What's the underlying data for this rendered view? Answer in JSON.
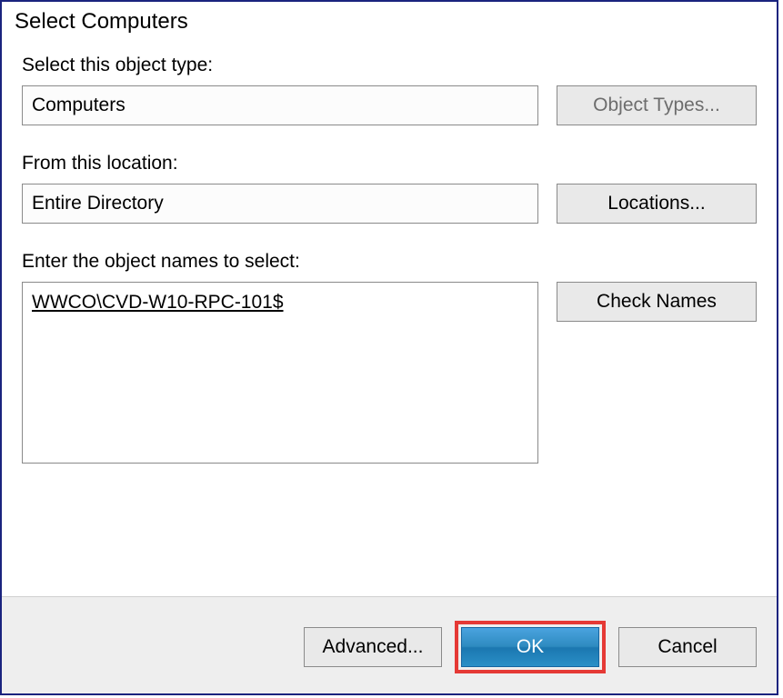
{
  "dialog": {
    "title": "Select Computers"
  },
  "object_type": {
    "label": "Select this object type:",
    "value": "Computers",
    "button": "Object Types..."
  },
  "location": {
    "label": "From this location:",
    "value": "Entire Directory",
    "button": "Locations..."
  },
  "object_names": {
    "label": "Enter the object names to select:",
    "value": "WWCO\\CVD-W10-RPC-101$",
    "button": "Check Names"
  },
  "footer": {
    "advanced": "Advanced...",
    "ok": "OK",
    "cancel": "Cancel"
  }
}
